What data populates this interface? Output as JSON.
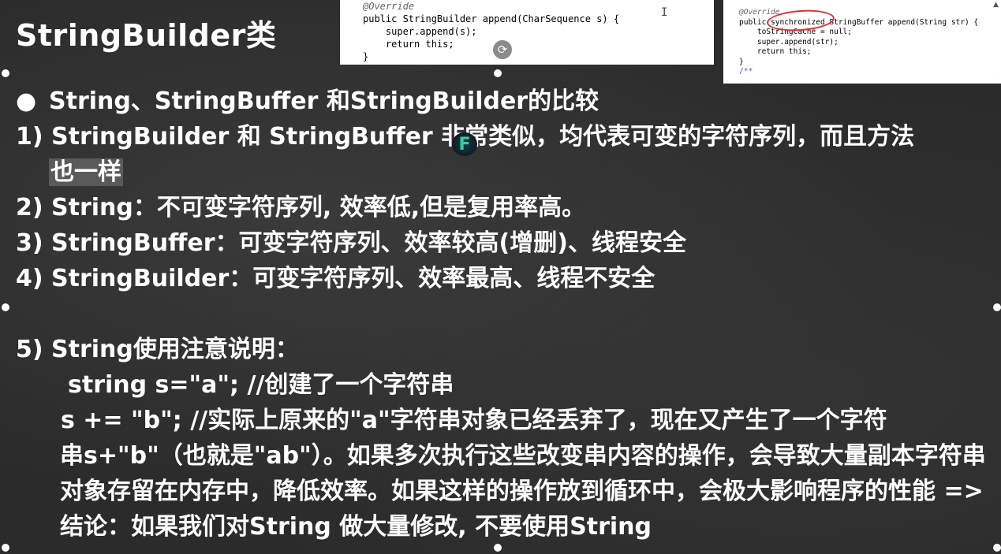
{
  "title": "StringBuilder类",
  "code_left": {
    "lines": [
      "@Override",
      "public StringBuilder append(CharSequence s) {",
      "    super.append(s);",
      "    return this;",
      "}"
    ]
  },
  "code_right": {
    "lines": [
      "@Override",
      "public synchronized StringBuffer append(String str) {",
      "    toStringCache = null;",
      "    super.append(str);",
      "    return this;",
      "}",
      "/**"
    ]
  },
  "bullet": "String、StringBuffer 和StringBuilder的比较",
  "item1_a": "1) StringBuilder 和 StringBuffer 非常类似，均代表可变的字符序列，而且方法",
  "item1_b": "也一样",
  "item2": "2) String：不可变字符序列, 效率低,但是复用率高。",
  "item3": "3) StringBuffer：可变字符序列、效率较高(增删)、线程安全",
  "item4": "4) StringBuilder：可变字符序列、效率最高、线程不安全",
  "item5": "5) String使用注意说明：",
  "code_example1": "string s=\"a\"; //创建了一个字符串",
  "code_example2": "s += \"b\"; //实际上原来的\"a\"字符串对象已经丢弃了，现在又产生了一个字符",
  "paragraph": "串s+\"b\"（也就是\"ab\"）。如果多次执行这些改变串内容的操作，会导致大量副本字符串对象存留在内存中，降低效率。如果这样的操作放到循环中，会极大影响程序的性能 => 结论：如果我们对String 做大量修改, 不要使用String"
}
